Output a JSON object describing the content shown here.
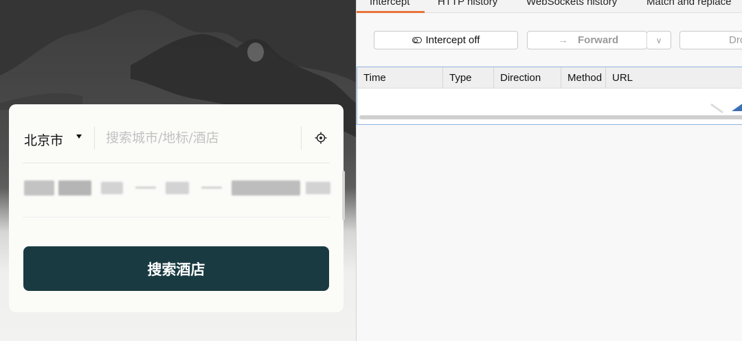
{
  "hotel_app": {
    "city": "北京市",
    "search_placeholder": "搜索城市/地标/酒店",
    "search_button_label": "搜索酒店"
  },
  "burp": {
    "tabs": [
      "Intercept",
      "HTTP history",
      "WebSockets history",
      "Match and replace"
    ],
    "active_tab": "Intercept",
    "intercept_toggle_label": "Intercept off",
    "forward_label": "Forward",
    "drop_label": "Dro",
    "table_columns": [
      "Time",
      "Type",
      "Direction",
      "Method",
      "URL"
    ],
    "accent_color": "#e8743b",
    "selection_border_color": "#8fb2e0"
  },
  "colors": {
    "search_button": "#193a40"
  },
  "icons": {
    "location": "crosshair-location-icon",
    "toggle": "toggle-switch-icon",
    "forward": "arrow-right-icon",
    "dropdown": "chevron-down-icon",
    "city_dropdown": "caret-down-icon"
  }
}
